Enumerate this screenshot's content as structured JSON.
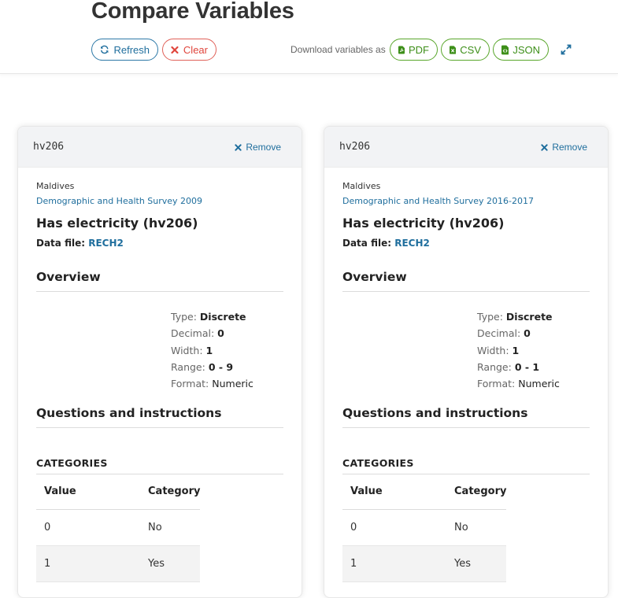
{
  "page": {
    "title": "Compare Variables"
  },
  "toolbar": {
    "refresh_label": "Refresh",
    "clear_label": "Clear",
    "download_label": "Download variables as",
    "pdf_label": "PDF",
    "csv_label": "CSV",
    "json_label": "JSON",
    "icons": [
      "refresh-icon",
      "close-icon",
      "file-pdf-icon",
      "file-csv-icon",
      "file-json-icon",
      "expand-icon"
    ]
  },
  "colors": {
    "accent": "#1f6e9d",
    "danger": "#e0453c",
    "success": "#3d8f19"
  },
  "cards": [
    {
      "code": "hv206",
      "remove_label": "Remove",
      "country": "Maldives",
      "survey": "Demographic and Health Survey 2009",
      "title": "Has electricity (hv206)",
      "datafile_label": "Data file:",
      "datafile": "RECH2",
      "overview_label": "Overview",
      "type_label": "Type:",
      "type": "Discrete",
      "decimal_label": "Decimal:",
      "decimal": "0",
      "width_label": "Width:",
      "width": "1",
      "range_label": "Range:",
      "range": "0 - 9",
      "format_label": "Format:",
      "format": "Numeric",
      "questions_label": "Questions and instructions",
      "categories_label": "CATEGORIES",
      "col_value": "Value",
      "col_category": "Category",
      "rows": [
        {
          "value": "0",
          "category": "No"
        },
        {
          "value": "1",
          "category": "Yes"
        }
      ]
    },
    {
      "code": "hv206",
      "remove_label": "Remove",
      "country": "Maldives",
      "survey": "Demographic and Health Survey 2016-2017",
      "title": "Has electricity (hv206)",
      "datafile_label": "Data file:",
      "datafile": "RECH2",
      "overview_label": "Overview",
      "type_label": "Type:",
      "type": "Discrete",
      "decimal_label": "Decimal:",
      "decimal": "0",
      "width_label": "Width:",
      "width": "1",
      "range_label": "Range:",
      "range": "0 - 1",
      "format_label": "Format:",
      "format": "Numeric",
      "questions_label": "Questions and instructions",
      "categories_label": "CATEGORIES",
      "col_value": "Value",
      "col_category": "Category",
      "rows": [
        {
          "value": "0",
          "category": "No"
        },
        {
          "value": "1",
          "category": "Yes"
        }
      ]
    }
  ]
}
